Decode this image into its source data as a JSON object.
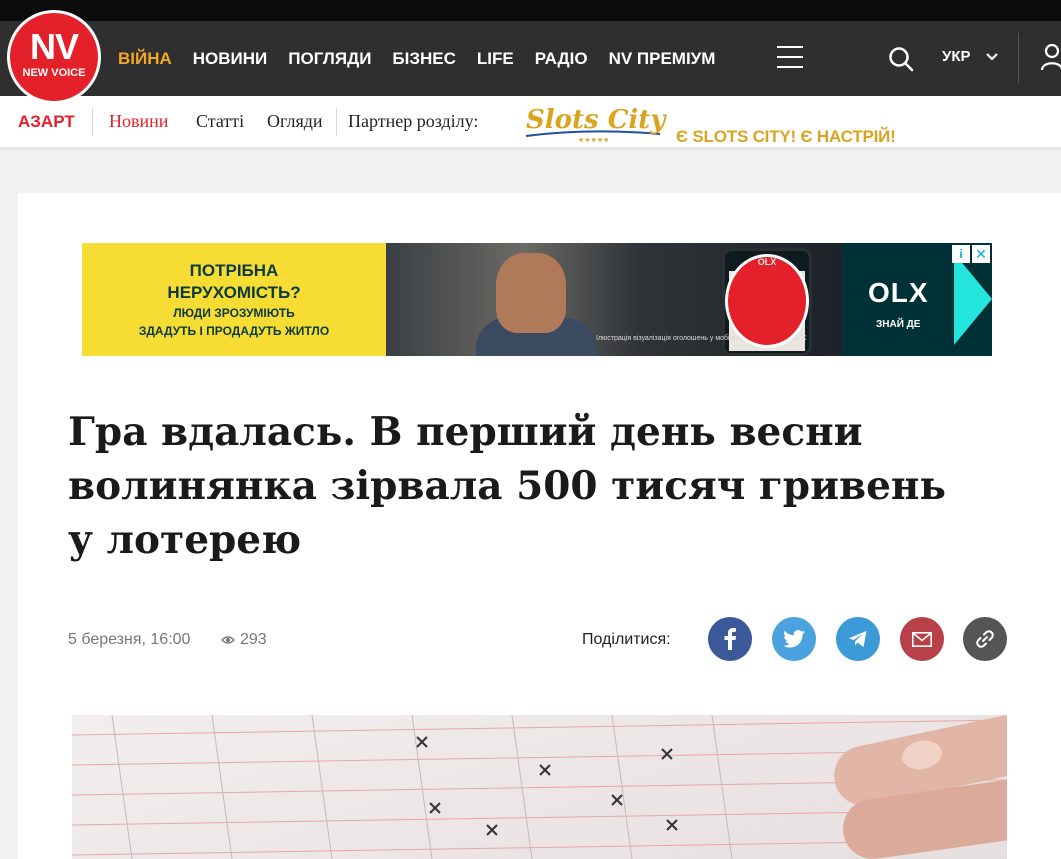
{
  "brand": {
    "logo_main": "NV",
    "logo_sub": "NEW VOICE",
    "primary_red": "#e4202a",
    "accent_orange": "#f5a623"
  },
  "nav": {
    "items": [
      "ВІЙНА",
      "НОВИНИ",
      "ПОГЛЯДИ",
      "БІЗНЕС",
      "LIFE",
      "РАДІО",
      "NV ПРЕМІУМ"
    ],
    "active_item": "ВІЙНА",
    "language": "УКР"
  },
  "subnav": {
    "section": "АЗАРТ",
    "items": [
      "Новини",
      "Статті",
      "Огляди"
    ],
    "active_item": "Новини",
    "partner_label": "Партнер розділу:",
    "partner_logo_text": "Slots City",
    "partner_tagline": "Є SLOTS CITY! Є НАСТРІЙ!"
  },
  "ad": {
    "line1": "ПОТРІБНА",
    "line2": "НЕРУХОМІСТЬ?",
    "line3": "ЛЮДИ ЗРОЗУМІЮТЬ",
    "line4": "ЗДАДУТЬ І ПРОДАДУТЬ ЖИТЛО",
    "brand": "OLX",
    "slogan": "ЗНАЙ ДЕ",
    "phone_logo": "OLX",
    "small_print": "Ілюстрація візуалізація оголошень у мобільному застосунку OLX"
  },
  "article": {
    "title": "Гра вдалась. В перший день весни волинянка зірвала 500 тисяч гривень у лотерею",
    "date": "5 березня, 16:00",
    "views": "293",
    "share_label": "Поділитися:"
  },
  "share": [
    "facebook",
    "twitter",
    "telegram",
    "email",
    "copy-link"
  ],
  "icons": [
    "menu-icon",
    "search-icon",
    "chevron-down-icon",
    "user-icon",
    "eye-icon",
    "facebook-icon",
    "twitter-icon",
    "telegram-icon",
    "mail-icon",
    "link-icon"
  ]
}
